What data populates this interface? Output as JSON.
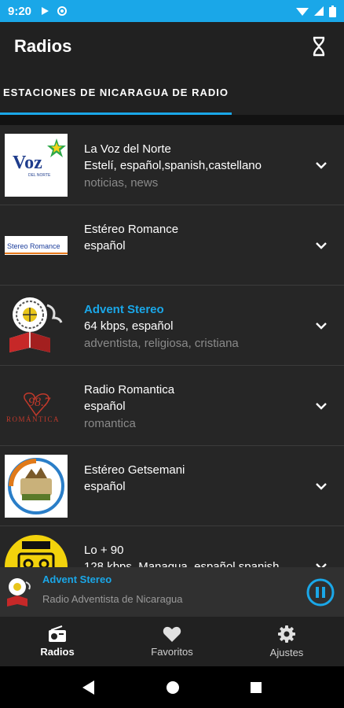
{
  "statusbar": {
    "time": "9:20"
  },
  "appbar": {
    "title": "Radios"
  },
  "tabs": [
    {
      "label": "ESTACIONES DE NICARAGUA DE RADIO"
    }
  ],
  "stations": [
    {
      "name": "La Voz del Norte",
      "desc": "Estelí, español,spanish,castellano",
      "tags": "noticias, news",
      "logo_text": "Voz",
      "logo_sub": "DEL NORTE"
    },
    {
      "name": "Estéreo Romance",
      "desc": "español",
      "tags": "",
      "logo_text": "Stereo Romance"
    },
    {
      "name": "Advent Stereo",
      "desc": "64 kbps, español",
      "tags": "adventista, religiosa, cristiana"
    },
    {
      "name": "Radio Romantica",
      "desc": "español",
      "tags": "romantica",
      "logo_text": "98.7",
      "logo_sub": "ROMÁNTICA"
    },
    {
      "name": "Estéreo Getsemani",
      "desc": "español",
      "tags": ""
    },
    {
      "name": "Lo + 90",
      "desc": "128 kbps, Managua, español,spanish,",
      "tags": ""
    }
  ],
  "player": {
    "name": "Advent Stereo",
    "subtitle": "Radio Adventista de Nicaragua"
  },
  "bottomnav": [
    {
      "label": "Radios",
      "icon": "radio-icon"
    },
    {
      "label": "Favoritos",
      "icon": "heart-icon"
    },
    {
      "label": "Ajustes",
      "icon": "gear-icon"
    }
  ],
  "colors": {
    "accent": "#1aa7e8",
    "background": "#262626"
  }
}
